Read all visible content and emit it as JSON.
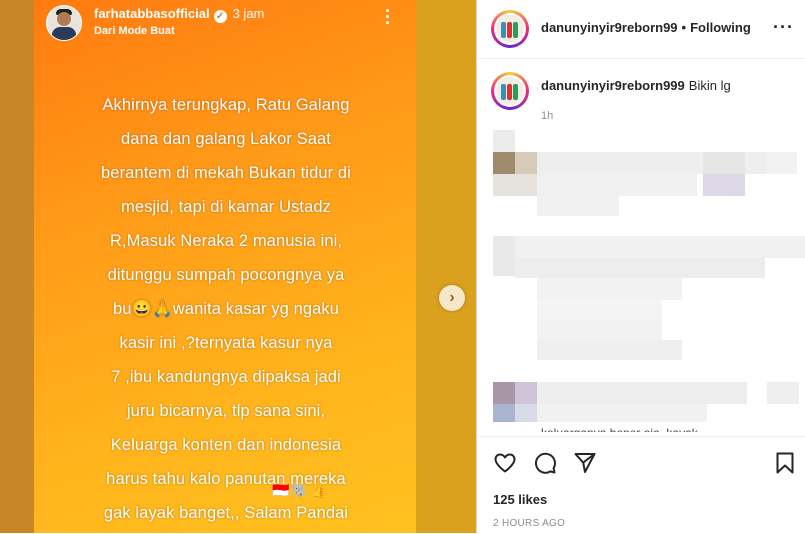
{
  "story": {
    "username": "farhatabbasofficial",
    "time": "3 jam",
    "subtitle": "Dari Mode Buat",
    "text_lines": [
      "Akhirnya terungkap, Ratu Galang",
      "dana dan  galang Lakor Saat",
      "berantem di mekah Bukan tidur di",
      "mesjid, tapi di kamar Ustadz",
      "R,Masuk Neraka 2 manusia ini,",
      "ditunggu sumpah pocongnya ya",
      "bu😀🙏wanita kasar yg ngaku",
      "kasir ini ,?ternyata kasur nya",
      "7 ,ibu kandungnya dipaksa jadi",
      "juru bicarnya, tlp sana sini,",
      "Keluarga konten dan indonesia",
      "harus tahu kalo  panutan mereka",
      "gak layak banget,,  Salam Pandai"
    ],
    "emoji_row": "🇮🇩🐘👍"
  },
  "post": {
    "header_username": "danunyinyir9reborn99",
    "following_label": "Following",
    "caption_username": "danunyinyir9reborn999",
    "caption_text": "Bikin lg",
    "caption_time": "1h",
    "partial_comment": "keluarganya bener aja, kayak",
    "likes": "125 likes",
    "posted": "2 HOURS AGO"
  },
  "icons": {
    "story_menu": "more-vertical-icon",
    "next": "chevron-right-icon",
    "more": "more-horizontal-icon",
    "like": "heart-outline-icon",
    "comment": "comment-bubble-icon",
    "share": "paper-plane-icon",
    "save": "bookmark-outline-icon"
  },
  "colors": {
    "story_gradient_start": "#ff7a10",
    "story_gradient_end": "#ffc21f",
    "text_primary": "#262626",
    "text_secondary": "#8e8e8e"
  }
}
